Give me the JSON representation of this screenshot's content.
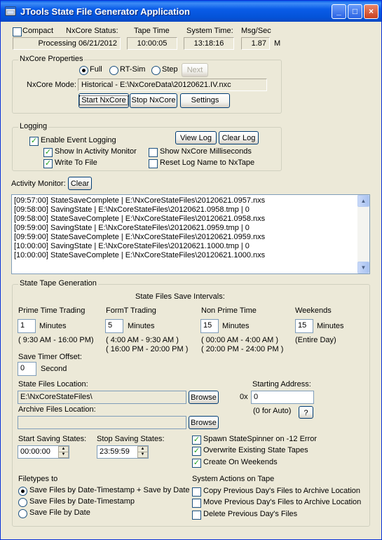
{
  "window": {
    "title": "JTools State File Generator Application",
    "buttons": {
      "minimize": "_",
      "maximize": "□",
      "close": "×"
    }
  },
  "status": {
    "compact_label": "Compact",
    "compact_checked": false,
    "nxcore_status_label": "NxCore Status:",
    "nxcore_status_value": "Processing 06/21/2012",
    "tape_time_label": "Tape Time",
    "tape_time_value": "10:00:05",
    "system_time_label": "System Time:",
    "system_time_value": "13:18:16",
    "msg_sec_label": "Msg/Sec",
    "msg_sec_value": "1.87",
    "msg_sec_unit": "M"
  },
  "nxcore_properties": {
    "legend": "NxCore Properties",
    "mode_options": [
      "Full",
      "RT-Sim",
      "Step"
    ],
    "mode_selected": "Full",
    "next_label": "Next",
    "mode_label": "NxCore Mode:",
    "mode_value": "Historical - E:\\NxCoreData\\20120621.IV.nxc",
    "start_label": "Start NxCore",
    "stop_label": "Stop NxCore",
    "settings_label": "Settings"
  },
  "logging": {
    "legend": "Logging",
    "enable_label": "Enable Event Logging",
    "show_activity_label": "Show In Activity Monitor",
    "write_file_label": "Write To File",
    "show_ms_label": "Show NxCore Milliseconds",
    "reset_log_label": "Reset Log Name to NxTape",
    "view_log_label": "View Log",
    "clear_log_label": "Clear Log"
  },
  "activity": {
    "label": "Activity Monitor:",
    "clear_label": "Clear",
    "lines": [
      "[09:57:00] StateSaveComplete | E:\\NxCoreStateFiles\\20120621.0957.nxs",
      "[09:58:00] SavingState | E:\\NxCoreStateFiles\\20120621.0958.tmp | 0",
      "[09:58:00] StateSaveComplete | E:\\NxCoreStateFiles\\20120621.0958.nxs",
      "[09:59:00] SavingState | E:\\NxCoreStateFiles\\20120621.0959.tmp | 0",
      "[09:59:00] StateSaveComplete | E:\\NxCoreStateFiles\\20120621.0959.nxs",
      "[10:00:00] SavingState | E:\\NxCoreStateFiles\\20120621.1000.tmp | 0",
      "[10:00:00] StateSaveComplete | E:\\NxCoreStateFiles\\20120621.1000.nxs"
    ]
  },
  "state_tape": {
    "legend": "State Tape Generation",
    "intervals_title": "State Files Save Intervals:",
    "prime_label": "Prime Time Trading",
    "prime_value": "1",
    "prime_unit": "Minutes",
    "prime_range": "( 9:30 AM - 16:00 PM)",
    "formt_label": "FormT Trading",
    "formt_value": "5",
    "formt_unit": "Minutes",
    "formt_range1": "( 4:00 AM - 9:30 AM )",
    "formt_range2": "( 16:00 PM - 20:00 PM )",
    "nonprime_label": "Non Prime Time",
    "nonprime_value": "15",
    "nonprime_unit": "Minutes",
    "nonprime_range1": "( 00:00 AM - 4:00 AM )",
    "nonprime_range2": "( 20:00 PM - 24:00 PM )",
    "weekends_label": "Weekends",
    "weekends_value": "15",
    "weekends_unit": "Minutes",
    "weekends_range": "(Entire Day)",
    "timer_offset_label": "Save Timer Offset:",
    "timer_offset_value": "0",
    "timer_offset_unit": "Second",
    "location_label": "State Files Location:",
    "location_value": "E:\\NxCoreStateFiles\\",
    "browse_label": "Browse",
    "archive_label": "Archive Files Location:",
    "archive_value": "",
    "start_addr_label": "Starting Address:",
    "start_addr_prefix": "0x",
    "start_addr_value": "0",
    "start_addr_hint": "(0 for Auto)",
    "help_label": "?",
    "start_saving_label": "Start Saving States:",
    "start_saving_value": "00:00:00",
    "stop_saving_label": "Stop Saving States:",
    "stop_saving_value": "23:59:59",
    "spawn_label": "Spawn StateSpinner on -12 Error",
    "overwrite_label": "Overwrite Existing State Tapes",
    "weekends_create_label": "Create On Weekends",
    "filetypes_label": "Filetypes to",
    "filetype_options": [
      "Save Files by Date-Timestamp + Save by Date",
      "Save Files by Date-Timestamp",
      "Save File by Date"
    ],
    "filetype_selected": 0,
    "system_actions_label": "System Actions on Tape",
    "copy_label": "Copy Previous Day's Files to Archive Location",
    "move_label": "Move Previous Day's Files to Archive Location",
    "delete_label": "Delete Previous Day's Files"
  }
}
